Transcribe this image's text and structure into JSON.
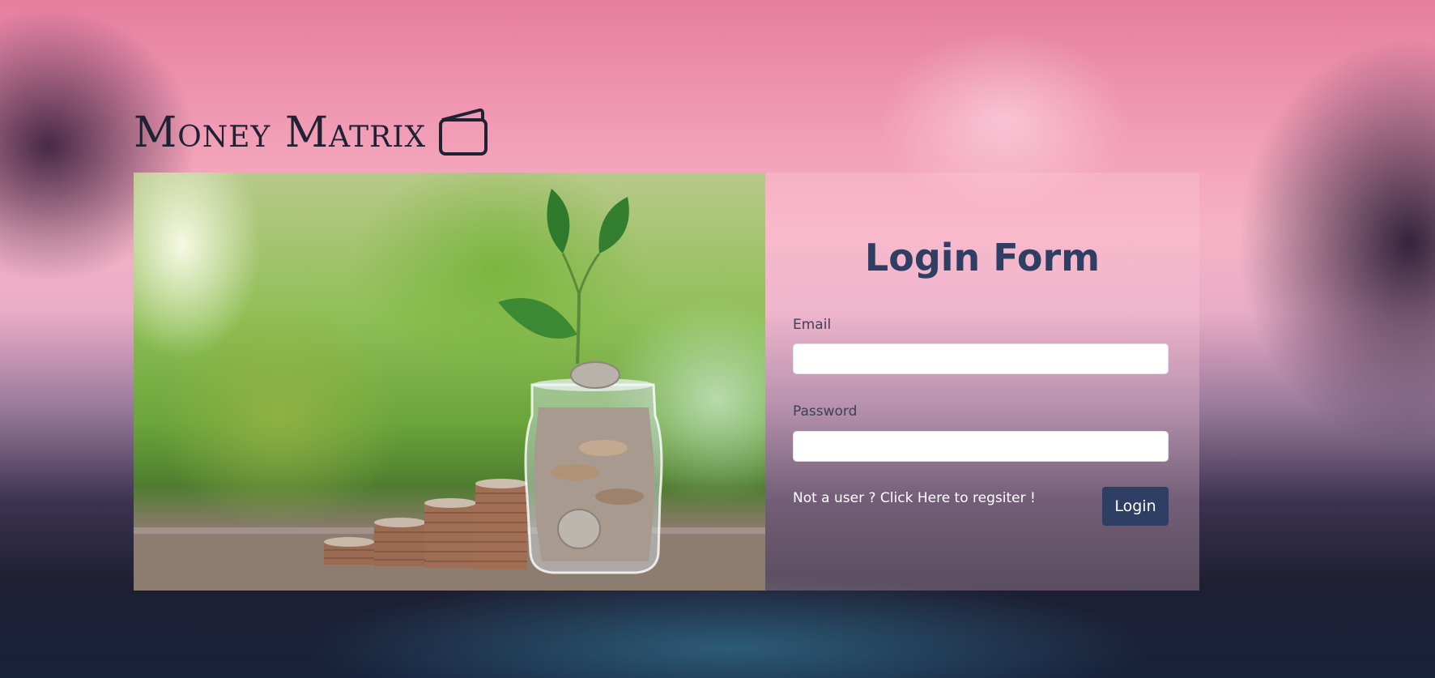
{
  "app": {
    "brand_name": "Money Matrix",
    "brand_icon": "wallet-icon"
  },
  "hero": {
    "image": "coins-jar-plant-photo"
  },
  "login_form": {
    "title": "Login Form",
    "email": {
      "label": "Email",
      "value": "",
      "placeholder": ""
    },
    "password": {
      "label": "Password",
      "value": "",
      "placeholder": ""
    },
    "register_link": "Not a user ? Click Here to regsiter !",
    "login_button": "Login"
  },
  "colors": {
    "accent": "#2f3e63",
    "brand_text": "#1f2233",
    "panel_tint": "#ffcddc"
  }
}
